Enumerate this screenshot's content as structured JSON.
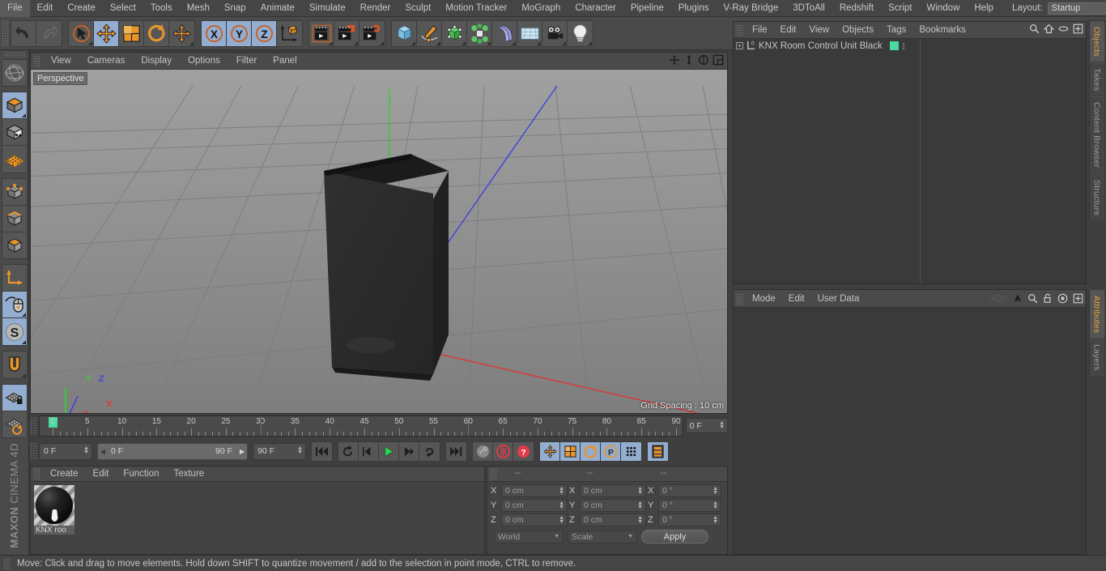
{
  "app": {
    "title": "MAXON CINEMA 4D",
    "brand_bold": "MAXON",
    "brand_light": "CINEMA 4D"
  },
  "menubar": {
    "items": [
      {
        "label": "File"
      },
      {
        "label": "Edit"
      },
      {
        "label": "Create"
      },
      {
        "label": "Select"
      },
      {
        "label": "Tools"
      },
      {
        "label": "Mesh"
      },
      {
        "label": "Snap"
      },
      {
        "label": "Animate"
      },
      {
        "label": "Simulate"
      },
      {
        "label": "Render"
      },
      {
        "label": "Sculpt"
      },
      {
        "label": "Motion Tracker"
      },
      {
        "label": "MoGraph"
      },
      {
        "label": "Character"
      },
      {
        "label": "Pipeline"
      },
      {
        "label": "Plugins"
      },
      {
        "label": "V-Ray Bridge"
      },
      {
        "label": "3DToAll"
      },
      {
        "label": "Redshift"
      },
      {
        "label": "Script"
      },
      {
        "label": "Window"
      },
      {
        "label": "Help"
      }
    ],
    "layout_label": "Layout:",
    "layout_value": "Startup"
  },
  "toolbar": {
    "groups": [
      {
        "name": "history",
        "buttons": [
          {
            "icon": "undo-icon",
            "selected": false
          },
          {
            "icon": "redo-icon",
            "selected": false
          }
        ]
      },
      {
        "name": "tools",
        "buttons": [
          {
            "icon": "select-cursor-icon",
            "selected": false
          },
          {
            "icon": "move-tool-icon",
            "selected": true
          },
          {
            "icon": "scale-tool-icon",
            "selected": false
          },
          {
            "icon": "rotate-tool-icon",
            "selected": false
          },
          {
            "icon": "move-alt-icon",
            "selected": false
          }
        ]
      },
      {
        "name": "axis-locks",
        "buttons": [
          {
            "icon": "axis-x-icon",
            "label": "X",
            "selected": true
          },
          {
            "icon": "axis-y-icon",
            "label": "Y",
            "selected": true
          },
          {
            "icon": "axis-z-icon",
            "label": "Z",
            "selected": true
          },
          {
            "icon": "world-axis-icon",
            "selected": false
          }
        ]
      },
      {
        "name": "render",
        "buttons": [
          {
            "icon": "render-view-icon",
            "selected": false
          },
          {
            "icon": "render-picture-viewer-icon",
            "selected": false
          },
          {
            "icon": "render-settings-icon",
            "selected": false
          }
        ]
      },
      {
        "name": "create",
        "buttons": [
          {
            "icon": "cube-primitive-icon",
            "selected": false
          },
          {
            "icon": "spline-pen-icon",
            "selected": false
          },
          {
            "icon": "nurbs-generator-icon",
            "selected": false
          },
          {
            "icon": "array-modeling-icon",
            "selected": false
          },
          {
            "icon": "deformer-bend-icon",
            "selected": false
          },
          {
            "icon": "floor-environment-icon",
            "selected": false
          },
          {
            "icon": "camera-icon",
            "selected": false
          },
          {
            "icon": "light-icon",
            "selected": false
          }
        ]
      }
    ]
  },
  "left_toolbar": {
    "groups": [
      {
        "buttons": [
          {
            "icon": "world-axis-globe-icon",
            "selected": false
          }
        ]
      },
      {
        "buttons": [
          {
            "icon": "editable-object-icon",
            "selected": true
          },
          {
            "icon": "model-mode-icon",
            "selected": false
          },
          {
            "icon": "texture-mode-icon",
            "selected": false
          }
        ]
      },
      {
        "buttons": [
          {
            "icon": "point-mode-icon",
            "selected": false
          },
          {
            "icon": "edge-mode-icon",
            "selected": false
          },
          {
            "icon": "polygon-mode-icon",
            "selected": false
          }
        ]
      },
      {
        "buttons": [
          {
            "icon": "axis-modify-icon",
            "selected": false
          },
          {
            "icon": "viewport-solo-mouse-icon",
            "selected": true
          },
          {
            "icon": "enable-snapping-s-icon",
            "selected": true
          }
        ]
      },
      {
        "buttons": [
          {
            "icon": "magnet-tool-icon",
            "selected": false
          }
        ]
      },
      {
        "buttons": [
          {
            "icon": "workplane-lock-icon",
            "selected": true
          },
          {
            "icon": "workplane-rotate-icon",
            "selected": false
          }
        ]
      }
    ]
  },
  "viewport": {
    "menu": [
      {
        "label": "View"
      },
      {
        "label": "Cameras"
      },
      {
        "label": "Display"
      },
      {
        "label": "Options"
      },
      {
        "label": "Filter"
      },
      {
        "label": "Panel"
      }
    ],
    "icons": [
      {
        "name": "pan-viewport-icon"
      },
      {
        "name": "dolly-viewport-icon"
      },
      {
        "name": "rotate-viewport-icon"
      },
      {
        "name": "maximize-viewport-icon"
      }
    ],
    "label": "Perspective",
    "grid_spacing": "Grid Spacing : 10 cm",
    "axis_gizmo": {
      "x": "X",
      "y": "Y",
      "z": "Z"
    }
  },
  "timeline": {
    "ticks": [
      0,
      5,
      10,
      15,
      20,
      25,
      30,
      35,
      40,
      45,
      50,
      55,
      60,
      65,
      70,
      75,
      80,
      85,
      90
    ],
    "current_frame": "0 F",
    "current_frame_field": "0 F",
    "range_start": "0 F",
    "range_end": "90 F",
    "end_frame_field": "90 F"
  },
  "transport": {
    "buttons": [
      {
        "icon": "go-to-start-icon",
        "selected": false
      },
      {
        "icon": "step-back-keyframe-icon",
        "selected": false
      },
      {
        "icon": "play-reverse-icon",
        "selected": false
      },
      {
        "icon": "play-forward-icon",
        "selected": false
      },
      {
        "icon": "step-forward-icon",
        "selected": false
      },
      {
        "icon": "loop-playback-icon",
        "selected": false
      },
      {
        "icon": "go-to-end-icon",
        "selected": false
      },
      {
        "icon": "record-active-objects-icon",
        "selected": false
      },
      {
        "icon": "autokeying-icon",
        "selected": false
      },
      {
        "icon": "keyframe-selection-icon",
        "selected": false
      },
      {
        "icon": "record-position-icon",
        "selected": true
      },
      {
        "icon": "record-scale-icon",
        "selected": true
      },
      {
        "icon": "record-rotation-icon",
        "selected": true
      },
      {
        "icon": "record-param-icon",
        "selected": true
      },
      {
        "icon": "record-pla-icon",
        "selected": true
      },
      {
        "icon": "timeline-dopesheet-icon",
        "selected": true
      }
    ]
  },
  "material_manager": {
    "menu": [
      {
        "label": "Create"
      },
      {
        "label": "Edit"
      },
      {
        "label": "Function"
      },
      {
        "label": "Texture"
      }
    ],
    "materials": [
      {
        "name": "KNX roo",
        "color": "#151515"
      }
    ]
  },
  "coordinates": {
    "headers": [
      "--",
      "--",
      "--"
    ],
    "position": {
      "label_x": "X",
      "label_y": "Y",
      "label_z": "Z",
      "x": "0 cm",
      "y": "0 cm",
      "z": "0 cm"
    },
    "size": {
      "label_x": "X",
      "label_y": "Y",
      "label_z": "Z",
      "x": "0 cm",
      "y": "0 cm",
      "z": "0 cm"
    },
    "rotation": {
      "label_x": "X",
      "label_y": "Y",
      "label_z": "Z",
      "x": "0 °",
      "y": "0 °",
      "z": "0 °"
    },
    "coord_system": "World",
    "transform_mode": "Scale",
    "apply_label": "Apply"
  },
  "object_manager": {
    "menu": [
      {
        "label": "File"
      },
      {
        "label": "Edit"
      },
      {
        "label": "View"
      },
      {
        "label": "Objects"
      },
      {
        "label": "Tags"
      },
      {
        "label": "Bookmarks"
      }
    ],
    "icons": [
      {
        "name": "search-icon"
      },
      {
        "name": "home-icon"
      },
      {
        "name": "ellipse-icon"
      },
      {
        "name": "new-window-icon"
      }
    ],
    "objects": [
      {
        "name": "KNX Room Control Unit Black",
        "expandable": true,
        "tag_color": "#4ad9a0"
      }
    ]
  },
  "attribute_manager": {
    "menu": [
      {
        "label": "Mode"
      },
      {
        "label": "Edit"
      },
      {
        "label": "User Data"
      }
    ],
    "icons": [
      {
        "name": "layers-stack-icon"
      },
      {
        "name": "pin-arrow-icon"
      },
      {
        "name": "search-icon"
      },
      {
        "name": "lock-open-icon"
      },
      {
        "name": "target-icon"
      },
      {
        "name": "new-window-icon"
      }
    ]
  },
  "tab_rails": {
    "top": [
      {
        "label": "Objects",
        "active": true
      },
      {
        "label": "Takes",
        "active": false
      },
      {
        "label": "Content Browser",
        "active": false
      },
      {
        "label": "Structure",
        "active": false
      }
    ],
    "bottom": [
      {
        "label": "Attributes",
        "active": true
      },
      {
        "label": "Layers",
        "active": false
      }
    ]
  },
  "statusbar": {
    "message": "Move: Click and drag to move elements. Hold down SHIFT to quantize movement / add to the selection in point mode, CTRL to remove."
  },
  "colors": {
    "accent_selected": "#93aed0",
    "tab_active": "#e8a33d",
    "tag_green": "#4ad9a0",
    "axis_x": "#d63c3c",
    "axis_y": "#3cc83c",
    "axis_z": "#4646dc",
    "panel_bg": "#3a3a3a",
    "toolbar_bg": "#4a4a4a"
  }
}
